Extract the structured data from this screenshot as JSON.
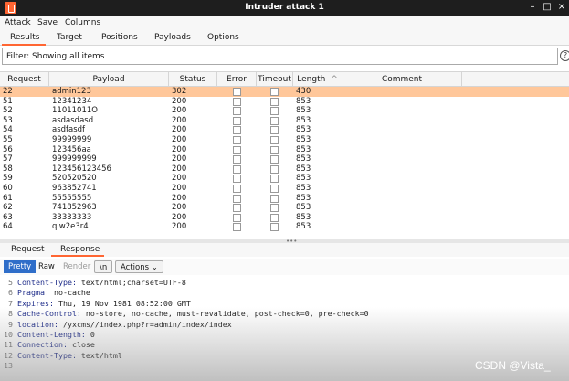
{
  "window": {
    "title": "Intruder attack 1",
    "minimize": "–",
    "maximize": "□",
    "close": "×"
  },
  "menu": [
    "Attack",
    "Save",
    "Columns"
  ],
  "main_tabs": [
    "Results",
    "Target",
    "Positions",
    "Payloads",
    "Options"
  ],
  "filter": {
    "label": "Filter: Showing all items",
    "help": "?"
  },
  "table": {
    "columns": [
      "Request",
      "Payload",
      "Status",
      "Error",
      "Timeout",
      "Length",
      "Comment"
    ],
    "sort_indicator": "^",
    "rows": [
      {
        "request": "22",
        "payload": "admin123",
        "status": "302",
        "length": "430",
        "selected": true
      },
      {
        "request": "51",
        "payload": "12341234",
        "status": "200",
        "length": "853"
      },
      {
        "request": "52",
        "payload": "11011011O",
        "status": "200",
        "length": "853"
      },
      {
        "request": "53",
        "payload": "asdasdasd",
        "status": "200",
        "length": "853"
      },
      {
        "request": "54",
        "payload": "asdfasdf",
        "status": "200",
        "length": "853"
      },
      {
        "request": "55",
        "payload": "99999999",
        "status": "200",
        "length": "853"
      },
      {
        "request": "56",
        "payload": "123456aa",
        "status": "200",
        "length": "853"
      },
      {
        "request": "57",
        "payload": "999999999",
        "status": "200",
        "length": "853"
      },
      {
        "request": "58",
        "payload": "123456123456",
        "status": "200",
        "length": "853"
      },
      {
        "request": "59",
        "payload": "520520520",
        "status": "200",
        "length": "853"
      },
      {
        "request": "60",
        "payload": "963852741",
        "status": "200",
        "length": "853"
      },
      {
        "request": "61",
        "payload": "55555555",
        "status": "200",
        "length": "853"
      },
      {
        "request": "62",
        "payload": "741852963",
        "status": "200",
        "length": "853"
      },
      {
        "request": "63",
        "payload": "33333333",
        "status": "200",
        "length": "853"
      },
      {
        "request": "64",
        "payload": "qlw2e3r4",
        "status": "200",
        "length": "853"
      }
    ]
  },
  "divider_grip": "•••",
  "detail_tabs": [
    "Request",
    "Response"
  ],
  "toolbar": {
    "pretty": "Pretty",
    "raw": "Raw",
    "render": "Render",
    "newline": "\\n",
    "actions": "Actions ⌄"
  },
  "response_lines": [
    {
      "num": "5",
      "key": "Content-Type:",
      "value": " text/html;charset=UTF-8"
    },
    {
      "num": "6",
      "key": "Pragma:",
      "value": " no-cache"
    },
    {
      "num": "7",
      "key": "Expires:",
      "value": " Thu, 19 Nov 1981 08:52:00 GMT"
    },
    {
      "num": "8",
      "key": "Cache-Control:",
      "value": " no-store, no-cache, must-revalidate, post-check=0, pre-check=0"
    },
    {
      "num": "9",
      "key": "location:",
      "value": " /yxcms//index.php?r=admin/index/index"
    },
    {
      "num": "10",
      "key": "Content-Length:",
      "value": " 0"
    },
    {
      "num": "11",
      "key": "Connection:",
      "value": " close"
    },
    {
      "num": "12",
      "key": "Content-Type:",
      "value": " text/html"
    },
    {
      "num": "13",
      "key": "",
      "value": ""
    }
  ],
  "watermark": "CSDN @Vista_",
  "colors": {
    "accent": "#ff6633",
    "selected_row": "#ffc79a",
    "pretty_active": "#2f6ec9"
  }
}
